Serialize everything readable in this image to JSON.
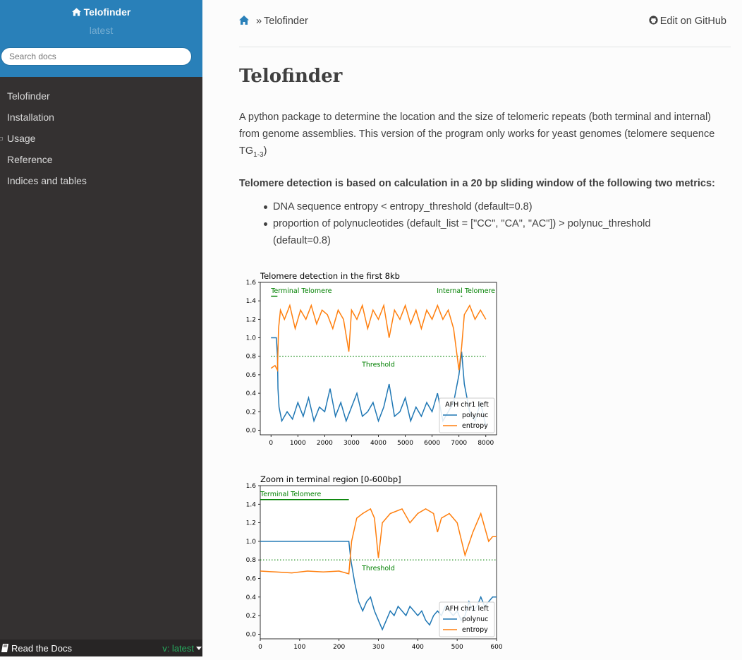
{
  "sidebar": {
    "project_title": "Telofinder",
    "version": "latest",
    "search_placeholder": "Search docs",
    "menu": [
      {
        "label": "Telofinder"
      },
      {
        "label": "Installation"
      },
      {
        "label": "Usage"
      },
      {
        "label": "Reference"
      },
      {
        "label": "Indices and tables"
      }
    ],
    "footer": {
      "label": "Read the Docs",
      "version": "v: latest"
    }
  },
  "breadcrumb": {
    "separator": "»",
    "current": "Telofinder",
    "edit_link": "Edit on GitHub"
  },
  "page": {
    "title": "Telofinder",
    "intro": "A python package to determine the location and the size of telomeric repeats (both terminal and internal) from genome assemblies. This version of the program only works for yeast genomes (telomere sequence TG",
    "intro_sub": "1-3",
    "intro_end": ")",
    "detection_heading": "Telomere detection is based on calculation in a 20 bp sliding window of the following two metrics:",
    "metrics": [
      "DNA sequence entropy < entropy_threshold (default=0.8)",
      "proportion of polynucleotides (default_list = [\"CC\", \"CA\", \"AC\"]) > polynuc_threshold (default=0.8)"
    ]
  },
  "colors": {
    "polynuc": "#1f77b4",
    "entropy": "#ff7f0e",
    "annotation": "#008000",
    "sidebar_top": "#2980b9",
    "sidebar_bg": "#343131"
  },
  "chart_data": [
    {
      "type": "line",
      "title": "Telomere detection in the first 8kb",
      "xlim": [
        -400,
        8400
      ],
      "ylim": [
        -0.05,
        1.6
      ],
      "xticks": [
        0,
        1000,
        2000,
        3000,
        4000,
        5000,
        6000,
        7000,
        8000
      ],
      "yticks": [
        0.0,
        0.2,
        0.4,
        0.6,
        0.8,
        1.0,
        1.2,
        1.4,
        1.6
      ],
      "threshold": {
        "y": 0.8,
        "label": "Threshold"
      },
      "annotations": [
        {
          "label": "Terminal Telomere",
          "x_start": 0,
          "x_end": 240,
          "y": 1.45
        },
        {
          "label": "Internal Telomere",
          "x_start": 7070,
          "x_end": 7120,
          "y": 1.45
        }
      ],
      "legend": {
        "title": "AFH chr1 left",
        "position": "lower right"
      },
      "series": [
        {
          "name": "polynuc",
          "color": "#1f77b4",
          "points": [
            [
              0,
              1.0
            ],
            [
              200,
              1.0
            ],
            [
              240,
              0.8
            ],
            [
              260,
              0.45
            ],
            [
              300,
              0.25
            ],
            [
              400,
              0.1
            ],
            [
              600,
              0.2
            ],
            [
              800,
              0.12
            ],
            [
              1000,
              0.3
            ],
            [
              1200,
              0.15
            ],
            [
              1400,
              0.35
            ],
            [
              1600,
              0.1
            ],
            [
              1800,
              0.25
            ],
            [
              2000,
              0.2
            ],
            [
              2200,
              0.45
            ],
            [
              2400,
              0.15
            ],
            [
              2600,
              0.3
            ],
            [
              2800,
              0.1
            ],
            [
              3000,
              0.25
            ],
            [
              3200,
              0.4
            ],
            [
              3400,
              0.15
            ],
            [
              3600,
              0.2
            ],
            [
              3800,
              0.3
            ],
            [
              4000,
              0.1
            ],
            [
              4200,
              0.25
            ],
            [
              4400,
              0.5
            ],
            [
              4600,
              0.15
            ],
            [
              4800,
              0.2
            ],
            [
              5000,
              0.35
            ],
            [
              5200,
              0.1
            ],
            [
              5400,
              0.25
            ],
            [
              5600,
              0.15
            ],
            [
              5800,
              0.3
            ],
            [
              6000,
              0.2
            ],
            [
              6200,
              0.4
            ],
            [
              6400,
              0.1
            ],
            [
              6600,
              0.2
            ],
            [
              6800,
              0.3
            ],
            [
              7000,
              0.6
            ],
            [
              7100,
              0.85
            ],
            [
              7200,
              0.5
            ],
            [
              7400,
              0.2
            ],
            [
              7600,
              0.1
            ],
            [
              7800,
              0.3
            ],
            [
              8000,
              0.05
            ]
          ]
        },
        {
          "name": "entropy",
          "color": "#ff7f0e",
          "points": [
            [
              0,
              0.67
            ],
            [
              150,
              0.7
            ],
            [
              240,
              0.65
            ],
            [
              280,
              1.1
            ],
            [
              350,
              1.3
            ],
            [
              500,
              1.2
            ],
            [
              700,
              1.35
            ],
            [
              900,
              1.1
            ],
            [
              1100,
              1.3
            ],
            [
              1300,
              1.2
            ],
            [
              1500,
              1.35
            ],
            [
              1700,
              1.15
            ],
            [
              1900,
              1.3
            ],
            [
              2100,
              1.25
            ],
            [
              2300,
              1.1
            ],
            [
              2500,
              1.3
            ],
            [
              2700,
              1.2
            ],
            [
              2900,
              0.85
            ],
            [
              3000,
              1.3
            ],
            [
              3200,
              1.2
            ],
            [
              3400,
              1.35
            ],
            [
              3600,
              1.1
            ],
            [
              3800,
              1.3
            ],
            [
              4000,
              1.2
            ],
            [
              4200,
              1.35
            ],
            [
              4400,
              1.0
            ],
            [
              4600,
              1.3
            ],
            [
              4800,
              1.2
            ],
            [
              5000,
              1.35
            ],
            [
              5200,
              1.15
            ],
            [
              5400,
              1.3
            ],
            [
              5600,
              1.1
            ],
            [
              5800,
              1.3
            ],
            [
              6000,
              1.2
            ],
            [
              6200,
              1.35
            ],
            [
              6400,
              1.2
            ],
            [
              6600,
              1.3
            ],
            [
              6800,
              1.1
            ],
            [
              7000,
              0.65
            ],
            [
              7100,
              0.9
            ],
            [
              7200,
              1.25
            ],
            [
              7400,
              1.35
            ],
            [
              7600,
              1.2
            ],
            [
              7800,
              1.3
            ],
            [
              8000,
              1.2
            ]
          ]
        }
      ]
    },
    {
      "type": "line",
      "title": "Zoom in terminal region [0-600bp]",
      "xlim": [
        0,
        600
      ],
      "ylim": [
        -0.05,
        1.6
      ],
      "xticks": [
        0,
        100,
        200,
        300,
        400,
        500,
        600
      ],
      "yticks": [
        0.0,
        0.2,
        0.4,
        0.6,
        0.8,
        1.0,
        1.2,
        1.4,
        1.6
      ],
      "threshold": {
        "y": 0.8,
        "label": "Threshold"
      },
      "annotations": [
        {
          "label": "Terminal Telomere",
          "x_start": 0,
          "x_end": 225,
          "y": 1.45
        }
      ],
      "legend": {
        "title": "AFH chr1 left",
        "position": "lower right"
      },
      "series": [
        {
          "name": "polynuc",
          "color": "#1f77b4",
          "points": [
            [
              0,
              1.0
            ],
            [
              100,
              1.0
            ],
            [
              200,
              1.0
            ],
            [
              225,
              1.0
            ],
            [
              230,
              0.8
            ],
            [
              240,
              0.55
            ],
            [
              250,
              0.35
            ],
            [
              260,
              0.25
            ],
            [
              270,
              0.35
            ],
            [
              280,
              0.4
            ],
            [
              290,
              0.25
            ],
            [
              300,
              0.15
            ],
            [
              310,
              0.05
            ],
            [
              320,
              0.15
            ],
            [
              330,
              0.25
            ],
            [
              340,
              0.2
            ],
            [
              350,
              0.3
            ],
            [
              360,
              0.25
            ],
            [
              370,
              0.2
            ],
            [
              380,
              0.3
            ],
            [
              390,
              0.25
            ],
            [
              400,
              0.2
            ],
            [
              410,
              0.25
            ],
            [
              420,
              0.15
            ],
            [
              430,
              0.1
            ],
            [
              440,
              0.2
            ],
            [
              450,
              0.25
            ],
            [
              460,
              0.2
            ],
            [
              470,
              0.3
            ],
            [
              480,
              0.25
            ],
            [
              490,
              0.2
            ],
            [
              500,
              0.25
            ],
            [
              510,
              0.15
            ],
            [
              520,
              0.2
            ],
            [
              530,
              0.35
            ],
            [
              540,
              0.25
            ],
            [
              550,
              0.3
            ],
            [
              560,
              0.4
            ],
            [
              570,
              0.3
            ],
            [
              580,
              0.35
            ],
            [
              590,
              0.4
            ],
            [
              600,
              0.4
            ]
          ]
        },
        {
          "name": "entropy",
          "color": "#ff7f0e",
          "points": [
            [
              0,
              0.68
            ],
            [
              40,
              0.67
            ],
            [
              80,
              0.66
            ],
            [
              120,
              0.68
            ],
            [
              160,
              0.67
            ],
            [
              200,
              0.68
            ],
            [
              225,
              0.65
            ],
            [
              232,
              1.0
            ],
            [
              245,
              1.25
            ],
            [
              260,
              1.3
            ],
            [
              280,
              1.35
            ],
            [
              290,
              1.25
            ],
            [
              300,
              0.82
            ],
            [
              310,
              1.2
            ],
            [
              330,
              1.3
            ],
            [
              360,
              1.35
            ],
            [
              380,
              1.2
            ],
            [
              400,
              1.3
            ],
            [
              420,
              1.35
            ],
            [
              440,
              1.3
            ],
            [
              450,
              1.1
            ],
            [
              460,
              1.25
            ],
            [
              480,
              1.3
            ],
            [
              500,
              1.2
            ],
            [
              520,
              0.85
            ],
            [
              540,
              1.1
            ],
            [
              560,
              1.3
            ],
            [
              580,
              1.0
            ],
            [
              590,
              1.05
            ],
            [
              600,
              1.05
            ]
          ]
        }
      ]
    }
  ]
}
